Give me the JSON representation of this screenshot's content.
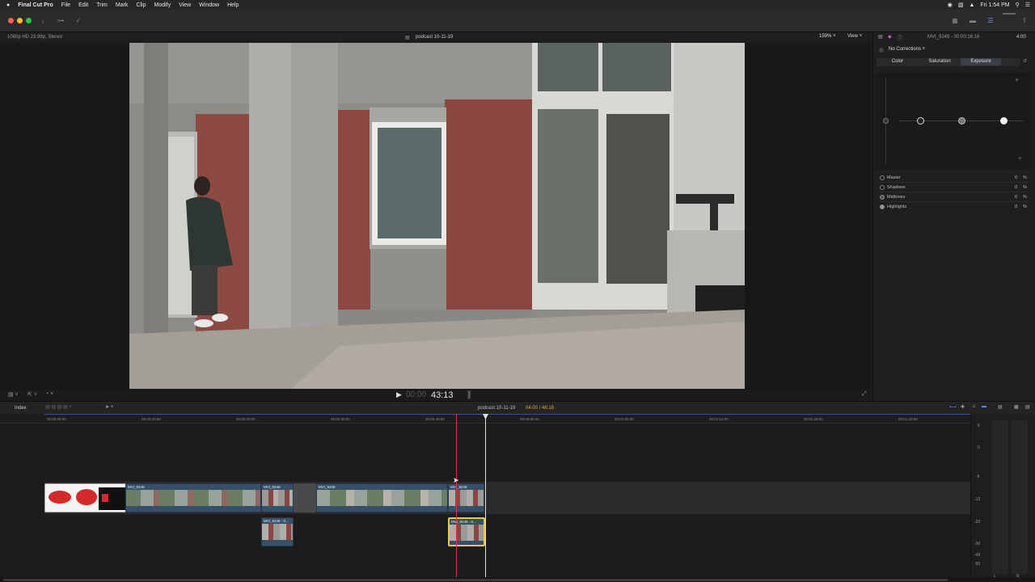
{
  "menubar": {
    "apple": "",
    "items": [
      "Final Cut Pro",
      "File",
      "Edit",
      "Trim",
      "Mark",
      "Clip",
      "Modify",
      "View",
      "Window",
      "Help"
    ],
    "clock": "Fri 1:54 PM"
  },
  "viewer": {
    "format_info": "1080p HD 23.98p, Stereo",
    "project_name": "podcast 10-11-19",
    "zoom": "159%",
    "view_menu": "View"
  },
  "playback": {
    "timecode": "43:13"
  },
  "inspector": {
    "clip_info": "MVI_9249 - 00:00:16:16",
    "duration": "4:00",
    "corrections": "No Corrections",
    "tabs": [
      "Color",
      "Saturation",
      "Exposure"
    ],
    "active_tab": "Exposure",
    "params": [
      {
        "name": "Master",
        "value": "0",
        "unit": "%"
      },
      {
        "name": "Shadows",
        "value": "0",
        "unit": "%"
      },
      {
        "name": "Midtones",
        "value": "0",
        "unit": "%"
      },
      {
        "name": "Highlights",
        "value": "0",
        "unit": "%"
      }
    ]
  },
  "timeline": {
    "index_label": "Index",
    "project_name": "podcast 10-11-19",
    "duration_info": "04:00 / 46:16",
    "ruler_labels": [
      "00:00:00:00",
      "00:00:10:00",
      "00:00:20:00",
      "00:00:30:00",
      "00:00:40:00",
      "00:00:50:00",
      "00:01:00:00",
      "00:01:10:00",
      "00:01:20:00",
      "00:01:30:00"
    ],
    "clips": [
      "MVI_9249",
      "MVI_9249",
      "MVI_9249",
      "MVI_9249"
    ],
    "connected_clips": [
      "MVI_9249 - 0...",
      "MVI_9249 - 0..."
    ]
  },
  "meters": {
    "scale": [
      "6",
      "0",
      "-6",
      "-12",
      "-20",
      "-30",
      "-40",
      "-50"
    ],
    "left": "L",
    "right": "R"
  },
  "colors": {
    "accent": "#4a6aff",
    "playhead": "#d23a3a",
    "skimmer": "#e0e0e0",
    "clip_blue": "#37506a",
    "selected_clip_border": "#e6c84a"
  }
}
